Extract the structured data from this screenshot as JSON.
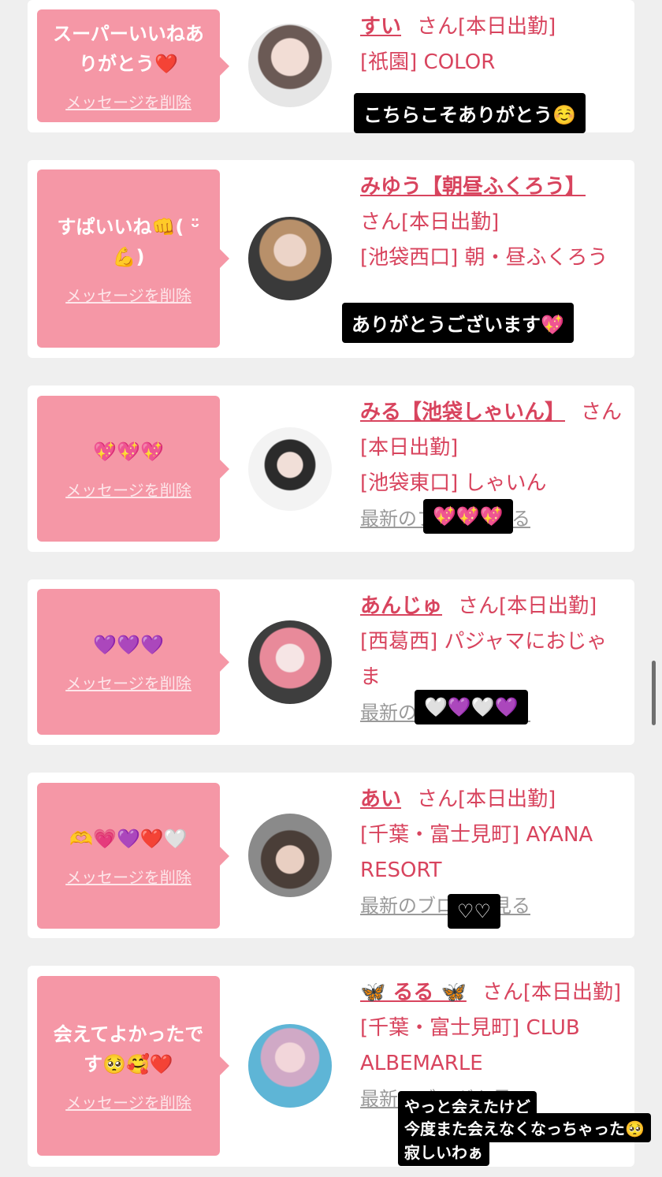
{
  "delete_label": "メッセージを削除",
  "suffix": "さん",
  "status": "[本日出勤]",
  "cards": [
    {
      "message": "スーパーいいねありがとう❤️",
      "cast_name": "すい",
      "area": "[祇園] COLOR",
      "story": "こちらこそありがとう☺️"
    },
    {
      "message": "すぱいいね👊( ᵕ̈ 💪)",
      "cast_name": "みゆう【朝昼ふくろう】",
      "area": "[池袋西口] 朝・昼ふくろう",
      "story": "ありがとうございます💖"
    },
    {
      "message": "💖💖💖",
      "cast_name": "みる【池袋しゃいん】",
      "area": "[池袋東口] しゃいん",
      "blog": "最新のブログを見る",
      "story": "💖💖💖"
    },
    {
      "message": "💜💜💜",
      "cast_name": "あんじゅ",
      "area": "[西葛西] パジャマにおじゃま",
      "blog": "最新のブログを見る",
      "story": "🤍💜🤍💜"
    },
    {
      "message": "🫶💗💜❤️🤍",
      "cast_name": "あい",
      "area": "[千葉・富士見町] AYANA RESORT",
      "blog": "最新のブログを見る",
      "story": "♡♡"
    },
    {
      "message": "会えてよかったです🥺🥰❤️",
      "cast_name": "🦋 るる 🦋",
      "area": "[千葉・富士見町] CLUB ALBEMARLE",
      "blog": "最新のブログを見る",
      "story_lines": [
        "やっと会えたけど",
        "今度また会えなくなっちゃった🥺",
        "寂しいわぁ"
      ]
    }
  ],
  "colors": {
    "background": "#efefef",
    "bubble": "#f597a6",
    "accent": "#d8445e"
  },
  "icons": [
    "avatar-photo",
    "butterfly-emoji"
  ]
}
